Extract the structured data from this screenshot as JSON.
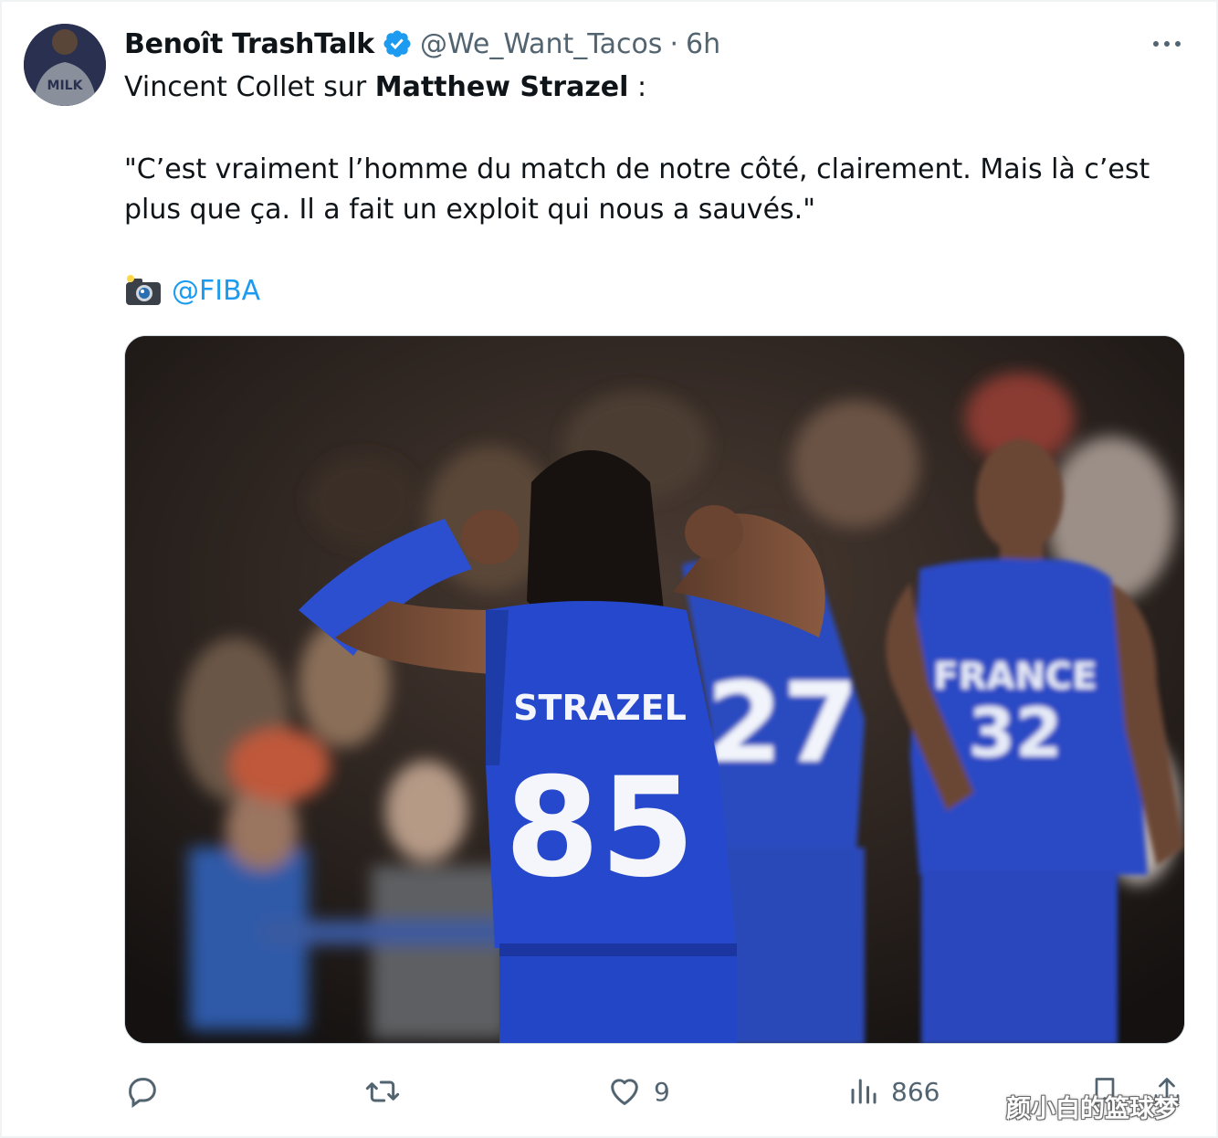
{
  "tweet": {
    "author_name": "Benoît TrashTalk",
    "handle": "@We_Want_Tacos",
    "separator": "·",
    "time": "6h",
    "verified": true,
    "text_intro": "Vincent Collet sur ",
    "text_bold": "Matthew Strazel",
    "text_colon": " :",
    "quote": "\"C’est vraiment l’homme du match de notre côté, clairement. Mais là c’est plus que ça. Il a fait un exploit qui nous a sauvés.\"",
    "credit_icon": "camera-flash-emoji",
    "credit_mention": "@FIBA",
    "avatar_text": "MILK"
  },
  "media": {
    "jersey_main_name": "STRAZEL",
    "jersey_main_number": "85",
    "jersey_mid_number": "27",
    "jersey_right_country": "FRANCE",
    "jersey_right_number": "32"
  },
  "actions": {
    "reply_icon": "reply-icon",
    "retweet_icon": "retweet-icon",
    "like_icon": "heart-icon",
    "like_count": "9",
    "views_icon": "views-chart-icon",
    "views_count": "866",
    "bookmark_icon": "bookmark-icon",
    "share_icon": "share-icon"
  },
  "watermark": "颜小白的篮球梦",
  "colors": {
    "accent": "#1d9bf0",
    "secondary_text": "#536471",
    "jersey_blue": "#2247c8"
  }
}
